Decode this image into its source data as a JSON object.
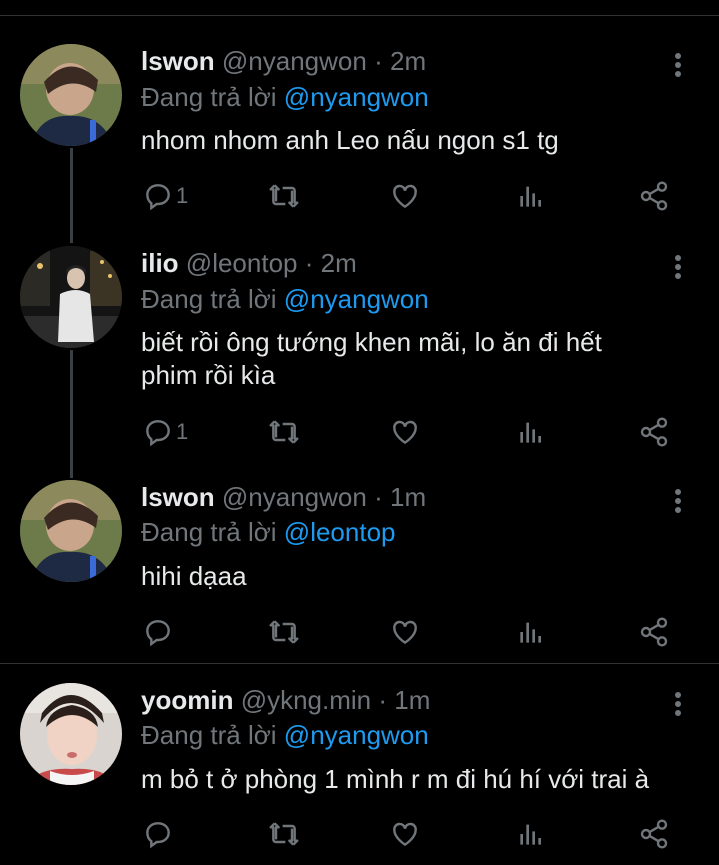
{
  "colors": {
    "background": "#000000",
    "text": "#e7e9ea",
    "muted": "#71767b",
    "link": "#1d9bf0"
  },
  "tweets": [
    {
      "name": "lswon",
      "handle": "@nyangwon",
      "time": "2m",
      "reply_prefix": "Đang trả lời",
      "reply_to": "@nyangwon",
      "text": "nhom nhom anh Leo nấu ngon s1 tg",
      "reply_count": "1",
      "avatar": "avatar-lswon"
    },
    {
      "name": "ilio",
      "handle": "@leontop",
      "time": "2m",
      "reply_prefix": "Đang trả lời",
      "reply_to": "@nyangwon",
      "text": "biết rồi ông tướng khen mãi, lo ăn đi hết phim rồi kìa",
      "reply_count": "1",
      "avatar": "avatar-ilio"
    },
    {
      "name": "lswon",
      "handle": "@nyangwon",
      "time": "1m",
      "reply_prefix": "Đang trả lời",
      "reply_to": "@leontop",
      "text": "hihi dạaa",
      "reply_count": "",
      "avatar": "avatar-lswon"
    },
    {
      "name": "yoomin",
      "handle": "@ykng.min",
      "time": "1m",
      "reply_prefix": "Đang trả lời",
      "reply_to": "@nyangwon",
      "text": "m bỏ t ở phòng 1 mình r m đi hú hí với trai à",
      "reply_count": "",
      "avatar": "avatar-yoomin"
    }
  ],
  "icons": [
    "reply-icon",
    "retweet-icon",
    "like-icon",
    "views-icon",
    "share-icon",
    "more-icon"
  ]
}
